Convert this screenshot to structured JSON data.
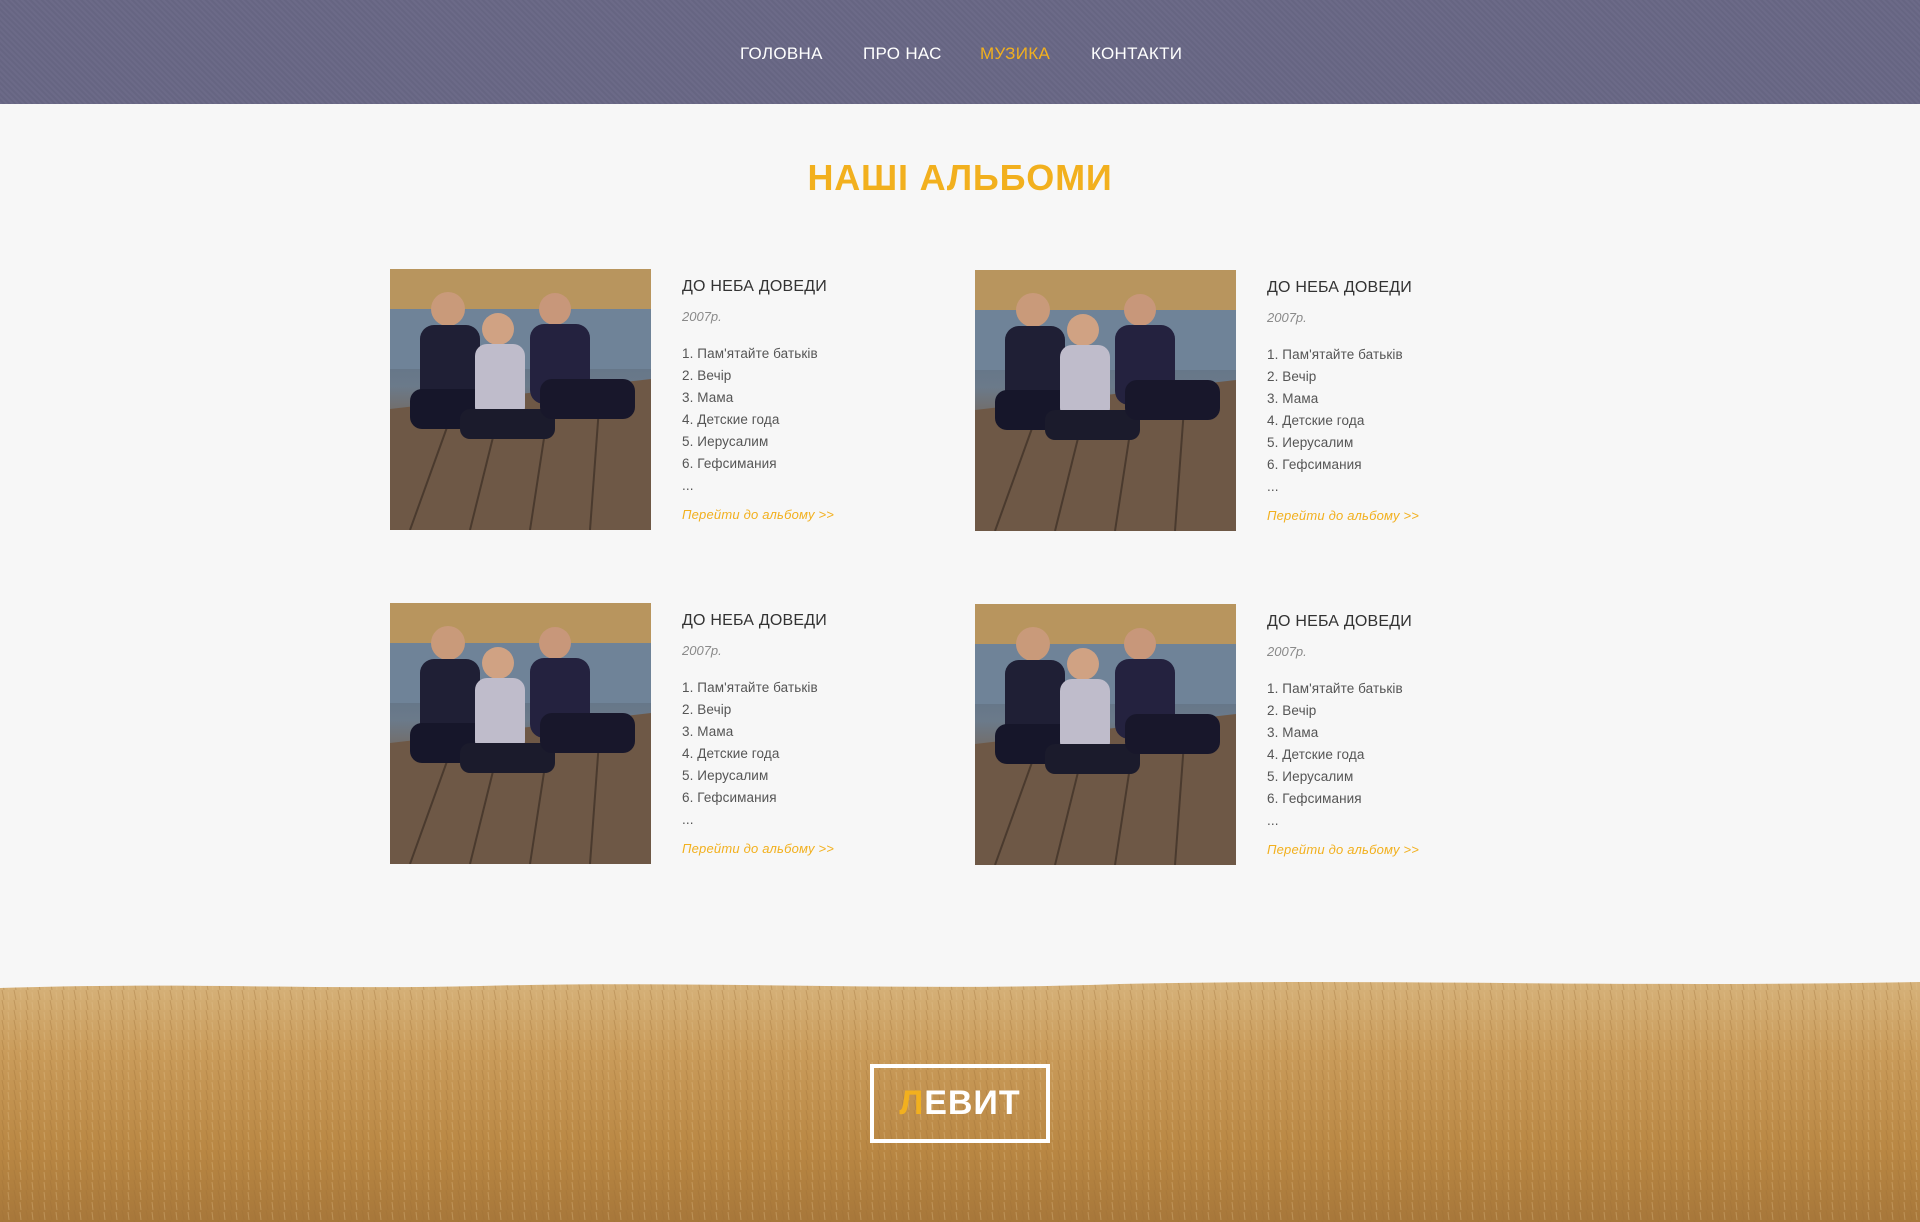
{
  "nav": {
    "items": [
      {
        "label": "ГОЛОВНА",
        "active": false
      },
      {
        "label": "ПРО НАС",
        "active": false
      },
      {
        "label": "МУЗИКА",
        "active": true
      },
      {
        "label": "КОНТАКТИ",
        "active": false
      }
    ]
  },
  "section": {
    "title": "НАШІ АЛЬБОМИ"
  },
  "albums": [
    {
      "title": "ДО НЕБА ДОВЕДИ",
      "year": "2007р.",
      "tracks": [
        "1. Пам'ятайте батьків",
        "2. Вечір",
        "3. Мама",
        "4. Детские года",
        "5. Иерусалим",
        "6. Гефсимания",
        "..."
      ],
      "link": "Перейти до альбому >>"
    },
    {
      "title": "ДО НЕБА ДОВЕДИ",
      "year": "2007р.",
      "tracks": [
        "1. Пам'ятайте батьків",
        "2. Вечір",
        "3. Мама",
        "4. Детские года",
        "5. Иерусалим",
        "6. Гефсимания",
        "..."
      ],
      "link": "Перейти до альбому >>"
    },
    {
      "title": "ДО НЕБА ДОВЕДИ",
      "year": "2007р.",
      "tracks": [
        "1. Пам'ятайте батьків",
        "2. Вечір",
        "3. Мама",
        "4. Детские года",
        "5. Иерусалим",
        "6. Гефсимания",
        "..."
      ],
      "link": "Перейти до альбому >>"
    },
    {
      "title": "ДО НЕБА ДОВЕДИ",
      "year": "2007р.",
      "tracks": [
        "1. Пам'ятайте батьків",
        "2. Вечір",
        "3. Мама",
        "4. Детские года",
        "5. Иерусалим",
        "6. Гефсимания",
        "..."
      ],
      "link": "Перейти до альбому >>"
    }
  ],
  "footer": {
    "logo_first": "Л",
    "logo_rest": "ЕВИТ"
  },
  "colors": {
    "accent": "#f2b01e",
    "nav_bg": "#686785",
    "page_bg": "#f7f7f7"
  }
}
